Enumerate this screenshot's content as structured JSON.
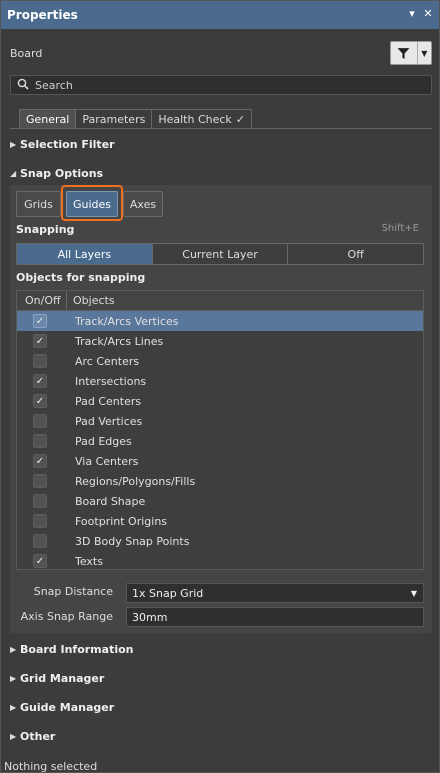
{
  "titlebar": {
    "title": "Properties",
    "pin": "▾",
    "close": "✕"
  },
  "board": {
    "label": "Board",
    "filter_icon": "filter-icon"
  },
  "search": {
    "placeholder": "Search"
  },
  "tabs": [
    {
      "label": "General",
      "active": true
    },
    {
      "label": "Parameters",
      "active": false
    },
    {
      "label": "Health Check",
      "active": false,
      "icon": "✓"
    }
  ],
  "sections": {
    "selection_filter": "Selection Filter",
    "snap_options": "Snap Options",
    "board_information": "Board Information",
    "grid_manager": "Grid Manager",
    "guide_manager": "Guide Manager",
    "other": "Other"
  },
  "snap": {
    "modes": [
      "Grids",
      "Guides",
      "Axes"
    ],
    "selected_mode": "Guides",
    "snapping_label": "Snapping",
    "shortcut": "Shift+E",
    "layers": [
      "All Layers",
      "Current Layer",
      "Off"
    ],
    "selected_layer": "All Layers",
    "objects_label": "Objects for snapping",
    "columns": [
      "On/Off",
      "Objects"
    ],
    "objects": [
      {
        "name": "Track/Arcs Vertices",
        "on": true,
        "selected": true
      },
      {
        "name": "Track/Arcs Lines",
        "on": true,
        "selected": false
      },
      {
        "name": "Arc Centers",
        "on": false,
        "selected": false
      },
      {
        "name": "Intersections",
        "on": true,
        "selected": false
      },
      {
        "name": "Pad Centers",
        "on": true,
        "selected": false
      },
      {
        "name": "Pad Vertices",
        "on": false,
        "selected": false
      },
      {
        "name": "Pad Edges",
        "on": false,
        "selected": false
      },
      {
        "name": "Via Centers",
        "on": true,
        "selected": false
      },
      {
        "name": "Regions/Polygons/Fills",
        "on": false,
        "selected": false
      },
      {
        "name": "Board Shape",
        "on": false,
        "selected": false
      },
      {
        "name": "Footprint Origins",
        "on": false,
        "selected": false
      },
      {
        "name": "3D Body Snap Points",
        "on": false,
        "selected": false
      },
      {
        "name": "Texts",
        "on": true,
        "selected": false
      }
    ],
    "snap_distance_label": "Snap Distance",
    "snap_distance_value": "1x Snap Grid",
    "axis_snap_range_label": "Axis Snap Range",
    "axis_snap_range_value": "30mm"
  },
  "status": {
    "text": "Nothing selected"
  },
  "colors": {
    "accent": "#4a6b8e",
    "highlight": "#f07020",
    "selected_row": "#59779b"
  }
}
